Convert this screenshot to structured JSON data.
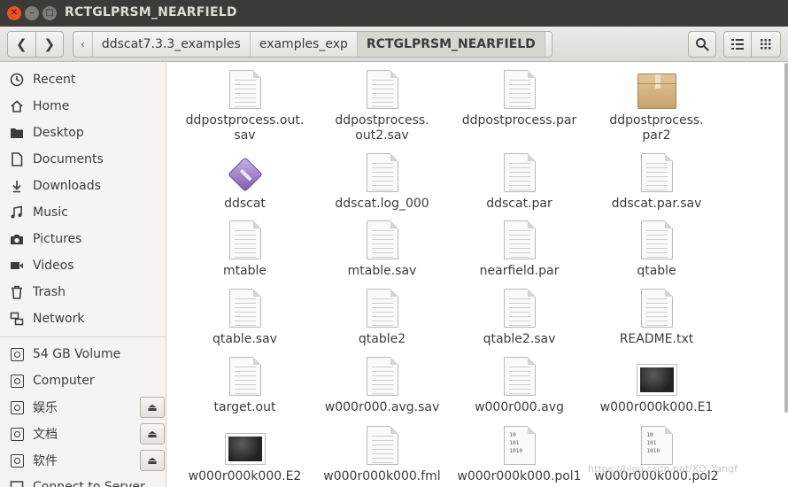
{
  "window": {
    "title": "RCTGLPRSM_NEARFIELD",
    "controls": [
      "close",
      "minimize",
      "maximize"
    ]
  },
  "toolbar": {
    "back_icon": "chevron-left",
    "forward_icon": "chevron-right",
    "breadcrumbs": [
      "ddscat7.3.3_examples",
      "examples_exp",
      "RCTGLPRSM_NEARFIELD"
    ],
    "search_icon": "search",
    "list_view_icon": "list-view",
    "grid_view_icon": "grid-view"
  },
  "sidebar": {
    "places": [
      {
        "label": "Recent",
        "icon": "clock-icon"
      },
      {
        "label": "Home",
        "icon": "home-icon"
      },
      {
        "label": "Desktop",
        "icon": "folder-icon"
      },
      {
        "label": "Documents",
        "icon": "document-icon"
      },
      {
        "label": "Downloads",
        "icon": "download-icon"
      },
      {
        "label": "Music",
        "icon": "music-icon"
      },
      {
        "label": "Pictures",
        "icon": "camera-icon"
      },
      {
        "label": "Videos",
        "icon": "video-icon"
      },
      {
        "label": "Trash",
        "icon": "trash-icon"
      },
      {
        "label": "Network",
        "icon": "network-icon"
      }
    ],
    "devices": [
      {
        "label": "54 GB Volume",
        "icon": "drive-icon",
        "eject": false
      },
      {
        "label": "Computer",
        "icon": "drive-icon",
        "eject": false
      },
      {
        "label": "娱乐",
        "icon": "drive-icon",
        "eject": true
      },
      {
        "label": "文档",
        "icon": "drive-icon",
        "eject": true
      },
      {
        "label": "软件",
        "icon": "drive-icon",
        "eject": true
      },
      {
        "label": "Connect to Server",
        "icon": "server-icon",
        "eject": false
      }
    ]
  },
  "files": [
    {
      "name": "ddpostprocess.out.\nsav",
      "type": "text"
    },
    {
      "name": "ddpostprocess.\nout2.sav",
      "type": "text"
    },
    {
      "name": "ddpostprocess.par",
      "type": "text"
    },
    {
      "name": "ddpostprocess.\npar2",
      "type": "archive"
    },
    {
      "name": "ddscat",
      "type": "executable"
    },
    {
      "name": "ddscat.log_000",
      "type": "text"
    },
    {
      "name": "ddscat.par",
      "type": "text"
    },
    {
      "name": "ddscat.par.sav",
      "type": "text"
    },
    {
      "name": "mtable",
      "type": "text"
    },
    {
      "name": "mtable.sav",
      "type": "text"
    },
    {
      "name": "nearfield.par",
      "type": "text"
    },
    {
      "name": "qtable",
      "type": "text"
    },
    {
      "name": "qtable.sav",
      "type": "text"
    },
    {
      "name": "qtable2",
      "type": "text"
    },
    {
      "name": "qtable2.sav",
      "type": "text"
    },
    {
      "name": "README.txt",
      "type": "text"
    },
    {
      "name": "target.out",
      "type": "text"
    },
    {
      "name": "w000r000.avg.sav",
      "type": "text"
    },
    {
      "name": "w000r000.avg",
      "type": "text"
    },
    {
      "name": "w000r000k000.E1",
      "type": "image"
    },
    {
      "name": "w000r000k000.E2",
      "type": "image"
    },
    {
      "name": "w000r000k000.fml",
      "type": "text"
    },
    {
      "name": "w000r000k000.pol1",
      "type": "binary"
    },
    {
      "name": "w000r000k000.pol2",
      "type": "binary"
    }
  ],
  "binary_icon_text": "10\n101\n1010",
  "watermark": "https://blog.csdn.net/XD_Yangf",
  "colors": {
    "titlebar": "#3c3b37",
    "close_button": "#e95420",
    "sidebar_bg": "#f5f4f3",
    "archive_brown": "#c9a36b",
    "executable_purple": "#7d5bb0"
  }
}
